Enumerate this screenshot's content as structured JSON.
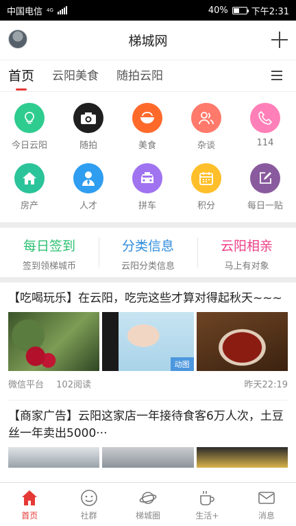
{
  "status_bar": {
    "carrier": "中国电信",
    "network": "4G",
    "battery": "40%",
    "time": "下午2:31"
  },
  "header": {
    "title": "梯城网"
  },
  "tabs": [
    {
      "label": "首页",
      "active": true
    },
    {
      "label": "云阳美食",
      "active": false
    },
    {
      "label": "随拍云阳",
      "active": false
    }
  ],
  "categories": [
    {
      "label": "今日云阳",
      "icon": "bulb-icon",
      "color": "#2ecc8f"
    },
    {
      "label": "随拍",
      "icon": "camera-icon",
      "color": "#1f1f1f"
    },
    {
      "label": "美食",
      "icon": "bowl-icon",
      "color": "#ff6a2b"
    },
    {
      "label": "杂谈",
      "icon": "people-icon",
      "color": "#ff7a6b"
    },
    {
      "label": "114",
      "icon": "phone-icon",
      "color": "#ff80b8"
    },
    {
      "label": "房产",
      "icon": "house-icon",
      "color": "#2bc49a"
    },
    {
      "label": "人才",
      "icon": "person-icon",
      "color": "#2f9ef0"
    },
    {
      "label": "拼车",
      "icon": "taxi-icon",
      "color": "#a073f0"
    },
    {
      "label": "积分",
      "icon": "calendar-icon",
      "color": "#ffbf2a"
    },
    {
      "label": "每日一贴",
      "icon": "edit-icon",
      "color": "#8a5a9e"
    }
  ],
  "quick_links": [
    {
      "title": "每日签到",
      "subtitle": "签到领梯城币",
      "color": "#2bbf6f"
    },
    {
      "title": "分类信息",
      "subtitle": "云阳分类信息",
      "color": "#2d8cdc"
    },
    {
      "title": "云阳相亲",
      "subtitle": "马上有对象",
      "color": "#ee3f86"
    }
  ],
  "articles": [
    {
      "title": "【吃喝玩乐】在云阳，吃完这些才算对得起秋天~~~",
      "thumb_badge": "动图",
      "source": "微信平台",
      "reads": "102阅读",
      "time": "昨天22:19"
    },
    {
      "title": "【商家广告】云阳这家店一年接待食客6万人次，土豆丝一年卖出5000···"
    }
  ],
  "bottom_nav": [
    {
      "label": "首页",
      "icon": "home-icon",
      "active": true
    },
    {
      "label": "社群",
      "icon": "smile-icon",
      "active": false
    },
    {
      "label": "梯城圈",
      "icon": "planet-icon",
      "active": false
    },
    {
      "label": "生活+",
      "icon": "cup-icon",
      "active": false
    },
    {
      "label": "消息",
      "icon": "mail-icon",
      "active": false
    }
  ],
  "colors": {
    "accent": "#e53935"
  }
}
